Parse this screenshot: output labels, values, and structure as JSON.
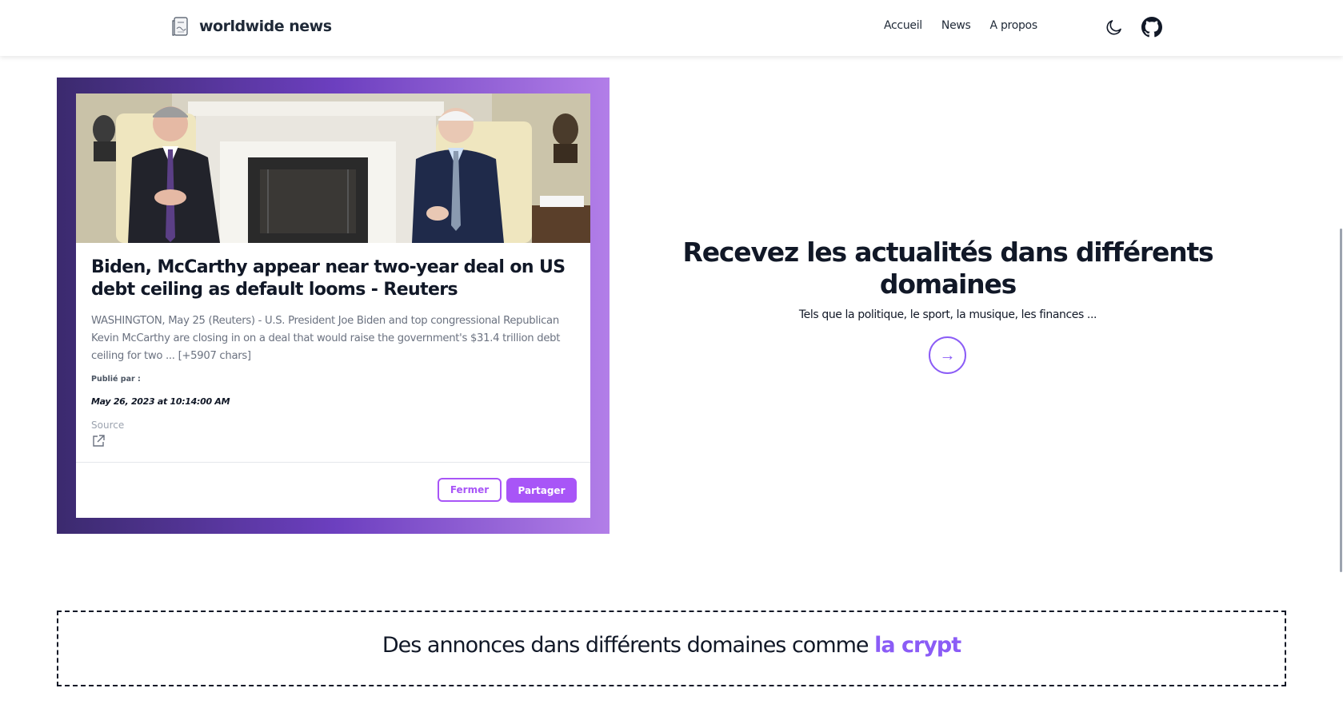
{
  "brand": {
    "name": "worldwide news",
    "icon": "newspaper-icon"
  },
  "nav": {
    "links": [
      "Accueil",
      "News",
      "A propos"
    ],
    "theme_icon": "moon-icon",
    "github_icon": "github-icon"
  },
  "article": {
    "title": "Biden, McCarthy appear near two-year deal on US debt ceiling as default looms - Reuters",
    "description": "WASHINGTON, May 25 (Reuters) - U.S. President Joe Biden and top congressional Republican Kevin McCarthy are closing in on a deal that would raise the government's $31.4 trillion debt ceiling for two ... [+5907 chars]",
    "published_label": "Publié par :",
    "published_date": "May 26, 2023 at 10:14:00 AM",
    "source_label": "Source",
    "close_label": "Fermer",
    "share_label": "Partager"
  },
  "hero": {
    "title": "Recevez les actualités dans différents domaines",
    "subtitle": "Tels que la politique, le sport, la musique, les finances ...",
    "arrow": "→"
  },
  "banner": {
    "text": "Des annonces dans différents domaines comme ",
    "accent": "la crypt"
  },
  "colors": {
    "accent": "#a855f7",
    "gradient_start": "#3b2a6e",
    "gradient_end": "#b27ee8"
  }
}
